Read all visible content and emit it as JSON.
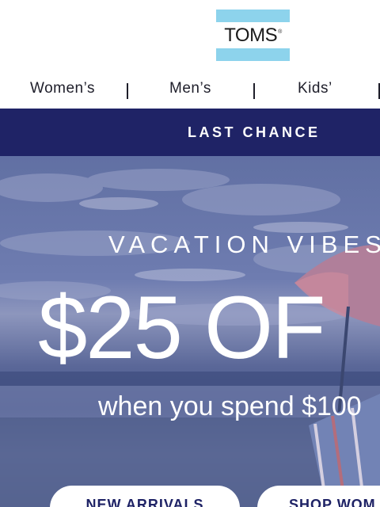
{
  "brand": {
    "logo_text": "TOMS",
    "registered": "®",
    "stripe_color": "#8dd3ec"
  },
  "nav": {
    "items": [
      {
        "label": "Women’s"
      },
      {
        "label": "Men’s"
      },
      {
        "label": "Kids’"
      }
    ],
    "separator": "|"
  },
  "banner": {
    "text": "LAST CHANCE",
    "color": "#1f2366"
  },
  "hero": {
    "subtitle": "VACATION VIBES",
    "headline": "$25 OF",
    "condition": "when you spend $100",
    "buttons": [
      {
        "label": "NEW ARRIVALS"
      },
      {
        "label": "SHOP WOM"
      }
    ]
  }
}
